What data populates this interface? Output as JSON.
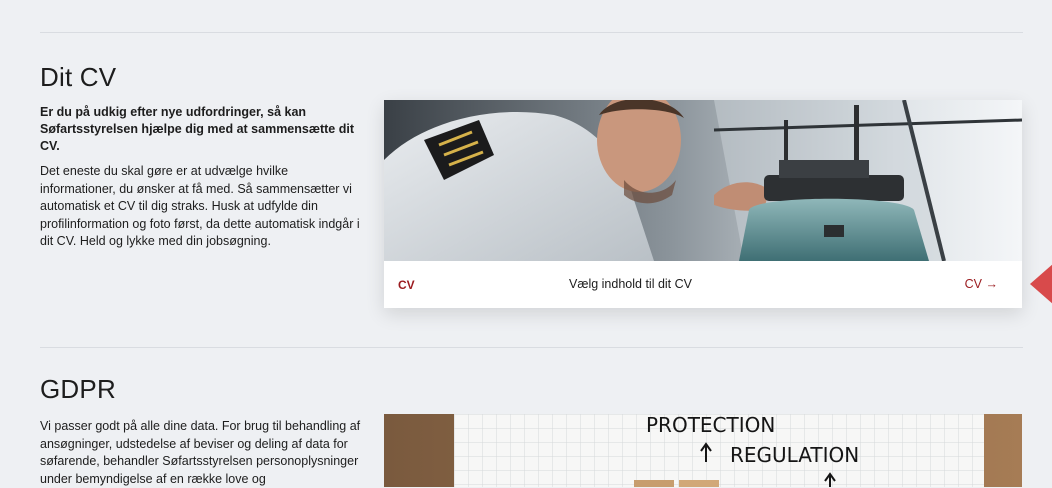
{
  "cv_section": {
    "title": "Dit CV",
    "lead": "Er du på udkig efter nye udfordringer, så kan Søfartsstyrelsen hjælpe dig med at sammensætte dit CV.",
    "body": "Det eneste du skal gøre er at udvælge hvilke informationer, du ønsker at få med. Så sammensætter vi automatisk et CV til dig straks. Husk at udfylde din profilinformation og foto først, da dette automatisk indgår i dit CV. Held og lykke med din jobsøgning.",
    "card": {
      "tag": "CV",
      "description": "Vælg indhold til dit CV",
      "link_label": "CV →"
    }
  },
  "gdpr_section": {
    "title": "GDPR",
    "body": "Vi passer godt på alle dine data. For brug til behandling af ansøgninger, udstedelse af beviser og deling af data for søfarende, behandler Søfartsstyrelsen personoplysninger under bemyndigelse af en række love og",
    "image_text_1": "PROTECTION",
    "image_text_2": "REGULATION"
  },
  "colors": {
    "background": "#eef0f3",
    "accent": "#9b1b1f",
    "side_arrow": "#d84a4b"
  }
}
